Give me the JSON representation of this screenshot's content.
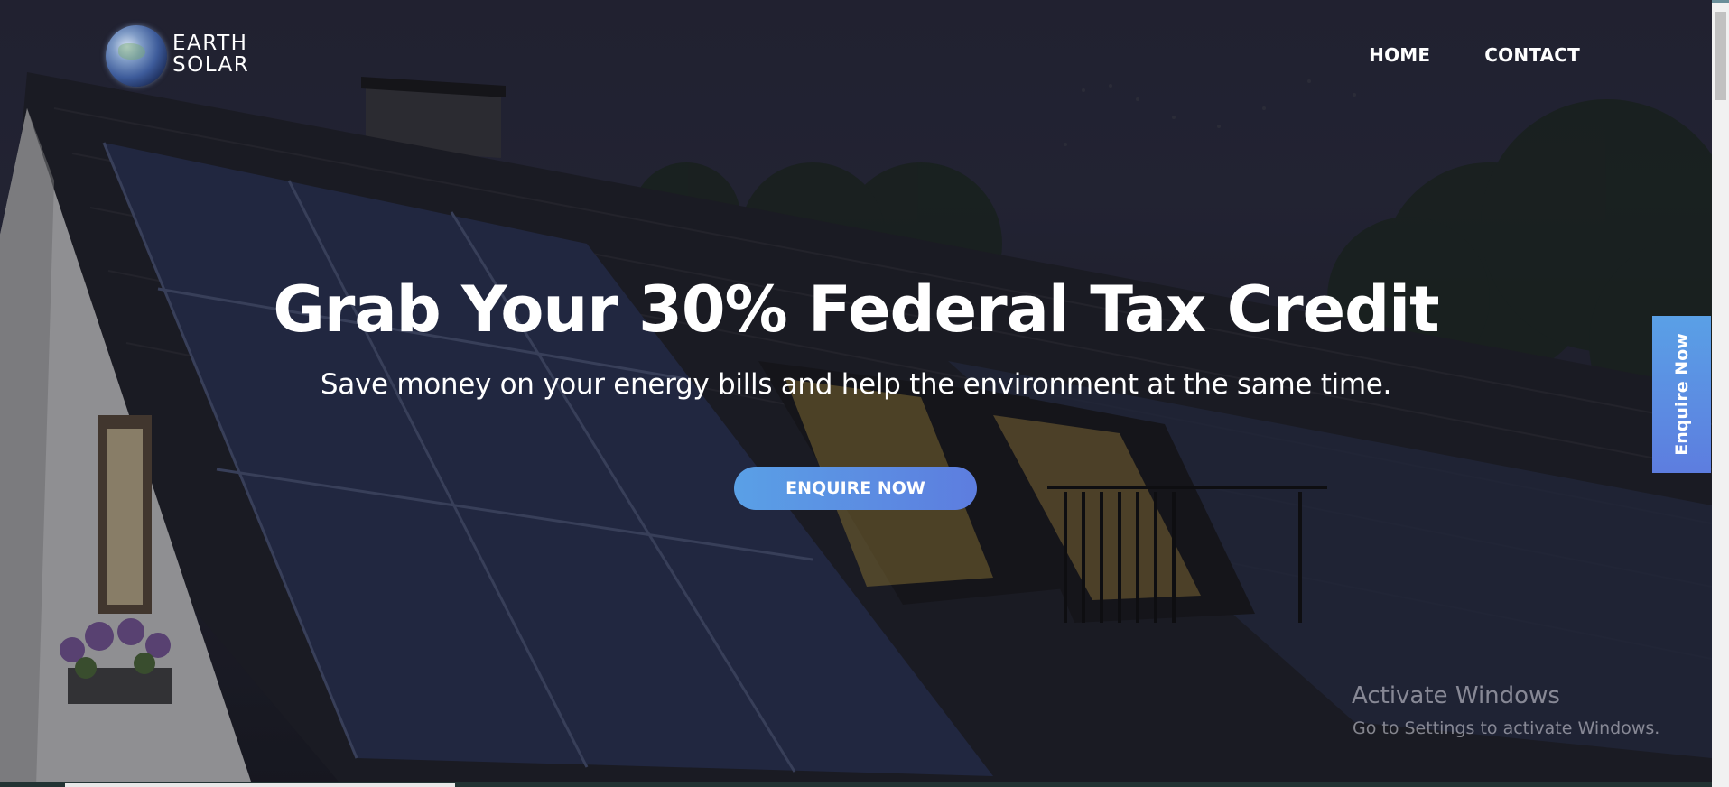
{
  "brand": {
    "line1": "EARTH",
    "line2": "SOLAR",
    "logo_icon": "earth-globe-icon"
  },
  "nav": {
    "items": [
      {
        "label": "HOME"
      },
      {
        "label": "CONTACT"
      }
    ]
  },
  "hero": {
    "headline": "Grab Your 30% Federal Tax Credit",
    "subheadline": "Save money on your energy bills and help the environment at the same time.",
    "cta_label": "ENQUIRE NOW"
  },
  "side_tab": {
    "label": "Enquire Now"
  },
  "watermark": {
    "title": "Activate Windows",
    "subtitle": "Go to Settings to activate Windows."
  },
  "colors": {
    "accent_start": "#5aa0e6",
    "accent_end": "#5d7ddf",
    "text": "#ffffff"
  }
}
